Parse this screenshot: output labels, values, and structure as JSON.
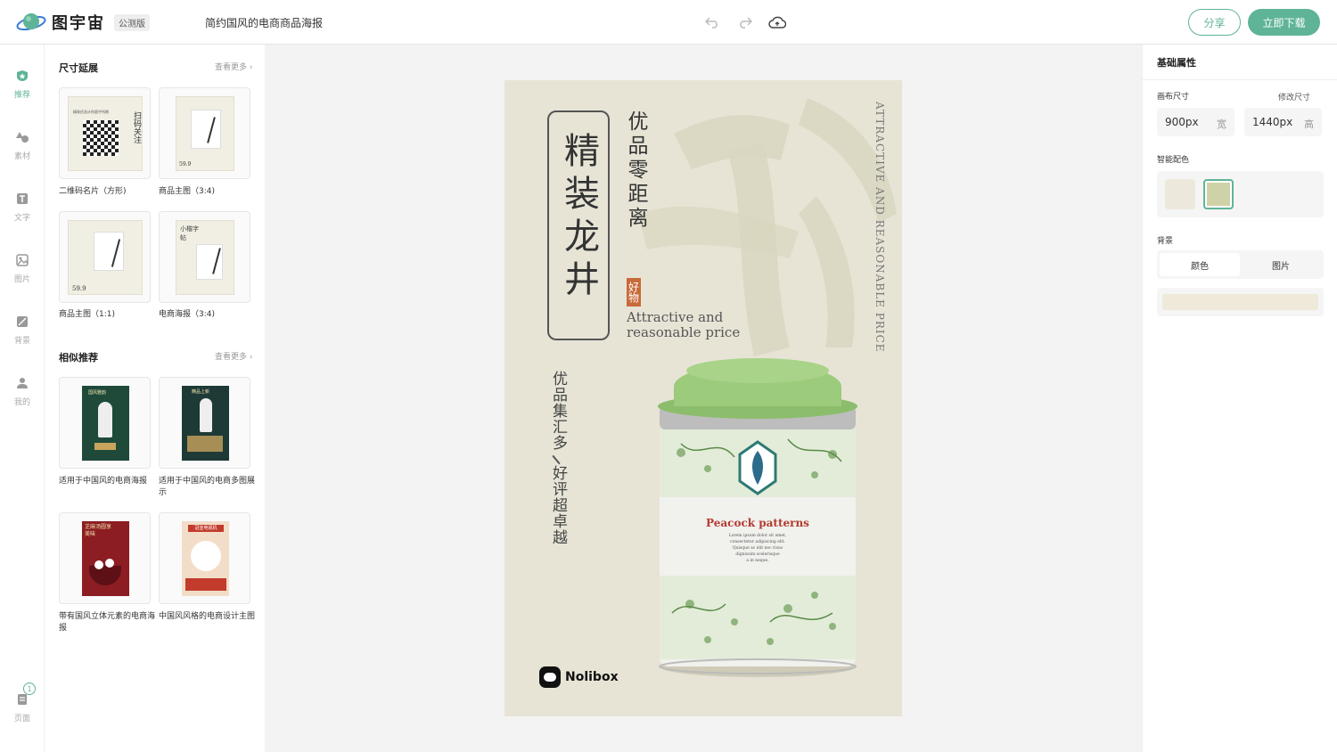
{
  "header": {
    "app_name": "图宇宙",
    "beta_badge": "公测版",
    "doc_title": "简约国风的电商商品海报",
    "share_label": "分享",
    "download_label": "立即下载"
  },
  "rail": {
    "items": [
      {
        "label": "推荐",
        "icon": "star-shield-icon",
        "active": true
      },
      {
        "label": "素材",
        "icon": "shapes-icon"
      },
      {
        "label": "文字",
        "icon": "text-icon"
      },
      {
        "label": "图片",
        "icon": "image-icon"
      },
      {
        "label": "背景",
        "icon": "background-icon"
      },
      {
        "label": "我的",
        "icon": "user-icon"
      }
    ],
    "pages_label": "页面",
    "pages_count": "1"
  },
  "panel": {
    "size_ext_title": "尺寸延展",
    "size_ext_more": "查看更多",
    "size_items": [
      {
        "caption": "二维码名片（方形)"
      },
      {
        "caption": "商品主图（3:4)"
      },
      {
        "caption": "商品主图（1:1)"
      },
      {
        "caption": "电商海报（3:4)"
      }
    ],
    "similar_title": "相似推荐",
    "similar_more": "查看更多",
    "similar_items": [
      {
        "caption": "适用于中国风的电商海报"
      },
      {
        "caption": "适用于中国风的电商多图展示"
      },
      {
        "caption": "带有国风立体元素的电商海报"
      },
      {
        "caption": "中国风风格的电商设计主图"
      }
    ],
    "thumb_texts": {
      "qr_title": "扫码关注",
      "qr_small": "精致优选计你超乎所期",
      "price": "59.9",
      "xiaokai": "小楷字帖",
      "poster1": "国风雅韵",
      "poster2": "精品上新",
      "poster3": "芝麻汤圆享美味",
      "poster4": "冠亚电视机"
    }
  },
  "poster": {
    "main_title": "精装龙井",
    "subtitle": "优品零距离",
    "seal": "好物",
    "en_line1": "Attractive and",
    "en_line2": "reasonable price",
    "vertical_en": "ATTRACTIVE AND REASONABLE PRICE",
    "slogan1": "优品集汇多",
    "slogan2": "好评超卓越",
    "brand": "Nolibox",
    "brand_suffix": "x",
    "can_brand": "Peacock patterns",
    "can_lorem": [
      "Lorem ipsum dolor sit amet,",
      "consectetur adipiscing elit.",
      "Quisque ac elit nec risus",
      "dignissim scelerisque",
      "a in neque."
    ]
  },
  "right": {
    "title": "基础属性",
    "canvas_size_label": "画布尺寸",
    "change_size_label": "修改尺寸",
    "width_value": "900px",
    "width_unit": "宽",
    "height_value": "1440px",
    "height_unit": "高",
    "smart_color_label": "智能配色",
    "swatches": [
      "#ede8dc",
      "#cfd2a6"
    ],
    "background_label": "背景",
    "bg_tab_color": "颜色",
    "bg_tab_image": "图片",
    "bg_color": "#efe9d9"
  },
  "colors": {
    "accent": "#5fb497"
  }
}
